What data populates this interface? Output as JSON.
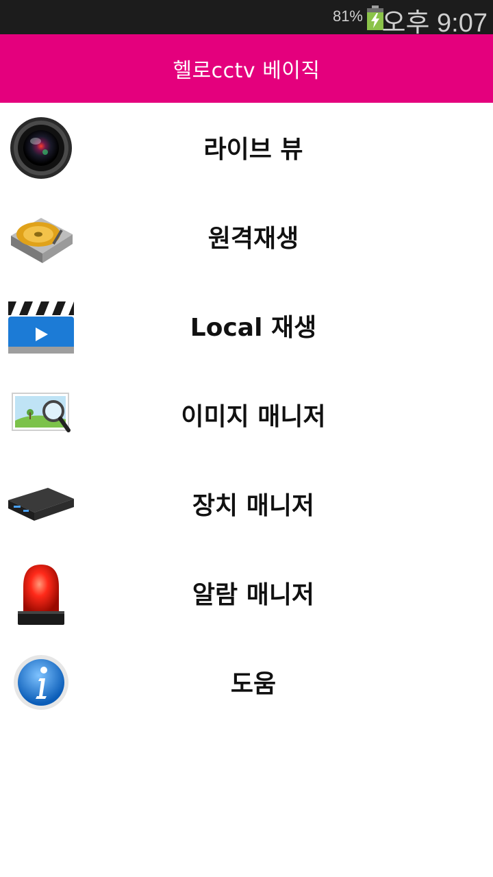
{
  "status_bar": {
    "battery_percent": "81%",
    "time": "오후 9:07"
  },
  "app_bar": {
    "title": "헬로cctv 베이직"
  },
  "menu": {
    "items": [
      {
        "label": "라이브 뷰",
        "icon": "camera-lens-icon"
      },
      {
        "label": "원격재생",
        "icon": "hard-drive-icon"
      },
      {
        "label": "Local 재생",
        "icon": "clapperboard-icon"
      },
      {
        "label": "이미지 매니저",
        "icon": "image-search-icon"
      },
      {
        "label": "장치 매니저",
        "icon": "dvr-device-icon"
      },
      {
        "label": "알람 매니저",
        "icon": "alarm-beacon-icon"
      },
      {
        "label": "도움",
        "icon": "info-icon"
      }
    ]
  },
  "colors": {
    "status_bar": "#1c1c1c",
    "app_bar": "#e4007d",
    "background": "#ffffff",
    "battery_charge": "#8bc34a"
  }
}
